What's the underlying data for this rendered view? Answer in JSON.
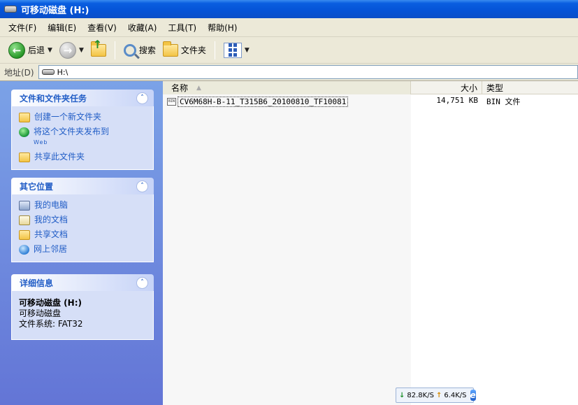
{
  "window": {
    "title": "可移动磁盘 (H:)"
  },
  "menu": [
    "文件(F)",
    "编辑(E)",
    "查看(V)",
    "收藏(A)",
    "工具(T)",
    "帮助(H)"
  ],
  "toolbar": {
    "back_label": "后退",
    "search_label": "搜索",
    "folders_label": "文件夹"
  },
  "address": {
    "label": "地址(D)",
    "value": "H:\\"
  },
  "tasks_panel": {
    "title": "文件和文件夹任务",
    "items": [
      "创建一个新文件夹",
      "将这个文件夹发布到",
      "共享此文件夹"
    ],
    "web_sub": "Web"
  },
  "places_panel": {
    "title": "其它位置",
    "items": [
      "我的电脑",
      "我的文档",
      "共享文档",
      "网上邻居"
    ]
  },
  "details_panel": {
    "title": "详细信息",
    "name": "可移动磁盘 (H:)",
    "kind": "可移动磁盘",
    "filesystem": "文件系统: FAT32"
  },
  "columns": {
    "name": "名称",
    "size": "大小",
    "type": "类型"
  },
  "files": [
    {
      "name": "CV6M68H-B-11_T315B6_20100810_TF10081",
      "size": "14,751 KB",
      "type": "BIN 文件"
    }
  ],
  "net_widget": {
    "down": "82.8K/S",
    "up": "6.4K/S"
  }
}
